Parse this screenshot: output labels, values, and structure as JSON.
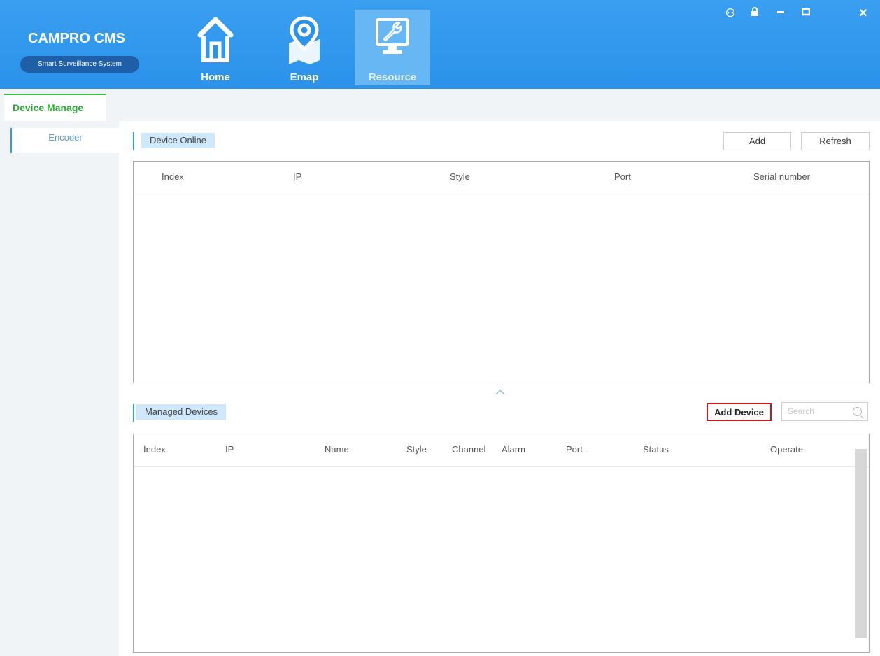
{
  "app": {
    "title": "CAMPRO CMS",
    "subtitle": "Smart Surveillance System"
  },
  "nav": {
    "items": [
      {
        "label": "Home",
        "icon": "home-icon"
      },
      {
        "label": "Emap",
        "icon": "map-pin-icon"
      },
      {
        "label": "Resource",
        "icon": "wrench-monitor-icon",
        "active": true
      }
    ]
  },
  "window_controls": [
    "user-switch-icon",
    "lock-icon",
    "minimize-icon",
    "maximize-icon",
    "close-icon"
  ],
  "tabs": {
    "device_manage": "Device Manage"
  },
  "sidebar": {
    "items": [
      {
        "label": "Encoder"
      }
    ]
  },
  "online": {
    "title": "Device Online",
    "add_label": "Add",
    "refresh_label": "Refresh",
    "columns": [
      "Index",
      "IP",
      "Style",
      "Port",
      "Serial number"
    ],
    "rows": []
  },
  "managed": {
    "title": "Managed Devices",
    "add_device_label": "Add Device",
    "search_placeholder": "Search",
    "columns": [
      "Index",
      "IP",
      "Name",
      "Style",
      "Channel",
      "Alarm",
      "Port",
      "Status",
      "Operate"
    ],
    "rows": []
  },
  "colors": {
    "header_blue": "#2b92ea",
    "active_tab_green": "#3fbf4a",
    "highlight_red": "#d0161c",
    "section_label_bg": "#cfe8fb"
  }
}
